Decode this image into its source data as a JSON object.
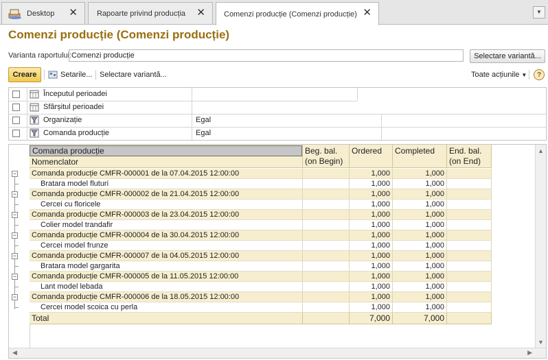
{
  "tabs": [
    {
      "label": "Desktop",
      "close": "✕"
    },
    {
      "label": "Rapoarte privind producția",
      "close": "✕"
    },
    {
      "label": "Comenzi producție (Comenzi producție)",
      "close": "✕"
    }
  ],
  "page_title": "Comenzi producție (Comenzi producție)",
  "variant": {
    "label": "Varianta raportului:",
    "value": "Comenzi producție",
    "select_button": "Selectare variantă..."
  },
  "toolbar": {
    "create": "Creare",
    "settings": "Setarile...",
    "select_variant": "Selectare variantă...",
    "all_actions": "Toate acțiunile",
    "help": "?"
  },
  "settings": [
    {
      "name": "Începutul perioadei",
      "value": ""
    },
    {
      "name": "Sfârșitul perioadei",
      "value": ""
    },
    {
      "name": "Organizație",
      "value": "Egal"
    },
    {
      "name": "Comanda producție",
      "value": "Egal"
    }
  ],
  "report": {
    "headers": {
      "col1_top": "Comanda producție",
      "col1_bottom": "Nomenclator",
      "beg_bal": "Beg. bal.\n(on Begin)",
      "ordered": "Ordered",
      "completed": "Completed",
      "end_bal": "End. bal.\n(on End)"
    },
    "rows": [
      {
        "type": "group",
        "name": "Comanda producție CMFR-000001 de la 07.04.2015 12:00:00",
        "beg": "",
        "ordered": "1,000",
        "completed": "1,000",
        "end": ""
      },
      {
        "type": "item",
        "name": "Bratara model fluturi",
        "beg": "",
        "ordered": "1,000",
        "completed": "1,000",
        "end": ""
      },
      {
        "type": "group",
        "name": "Comanda producție CMFR-000002 de la 21.04.2015 12:00:00",
        "beg": "",
        "ordered": "1,000",
        "completed": "1,000",
        "end": ""
      },
      {
        "type": "item",
        "name": "Cercei cu floricele",
        "beg": "",
        "ordered": "1,000",
        "completed": "1,000",
        "end": ""
      },
      {
        "type": "group",
        "name": "Comanda producție CMFR-000003 de la 23.04.2015 12:00:00",
        "beg": "",
        "ordered": "1,000",
        "completed": "1,000",
        "end": ""
      },
      {
        "type": "item",
        "name": "Colier model trandafir",
        "beg": "",
        "ordered": "1,000",
        "completed": "1,000",
        "end": ""
      },
      {
        "type": "group",
        "name": "Comanda producție CMFR-000004 de la 30.04.2015 12:00:00",
        "beg": "",
        "ordered": "1,000",
        "completed": "1,000",
        "end": ""
      },
      {
        "type": "item",
        "name": "Cercei model frunze",
        "beg": "",
        "ordered": "1,000",
        "completed": "1,000",
        "end": ""
      },
      {
        "type": "group",
        "name": "Comanda producție CMFR-000007 de la 04.05.2015 12:00:00",
        "beg": "",
        "ordered": "1,000",
        "completed": "1,000",
        "end": ""
      },
      {
        "type": "item",
        "name": "Bratara model gargarita",
        "beg": "",
        "ordered": "1,000",
        "completed": "1,000",
        "end": ""
      },
      {
        "type": "group",
        "name": "Comanda producție CMFR-000005 de la 11.05.2015 12:00:00",
        "beg": "",
        "ordered": "1,000",
        "completed": "1,000",
        "end": ""
      },
      {
        "type": "item",
        "name": "Lant model lebada",
        "beg": "",
        "ordered": "1,000",
        "completed": "1,000",
        "end": ""
      },
      {
        "type": "group",
        "name": "Comanda producție CMFR-000006 de la 18.05.2015 12:00:00",
        "beg": "",
        "ordered": "1,000",
        "completed": "1,000",
        "end": ""
      },
      {
        "type": "item",
        "name": "Cercei model scoica cu perla",
        "beg": "",
        "ordered": "1,000",
        "completed": "1,000",
        "end": ""
      }
    ],
    "total": {
      "label": "Total",
      "ordered": "7,000",
      "completed": "7,000"
    }
  },
  "icons": {
    "home": "desktop-icon",
    "settings": "gear-icon",
    "period": "calendar-icon",
    "filter": "filter-icon"
  },
  "colors": {
    "title": "#9a6e10",
    "create_button": "#f0c94f",
    "report_header": "#f6eecf"
  }
}
